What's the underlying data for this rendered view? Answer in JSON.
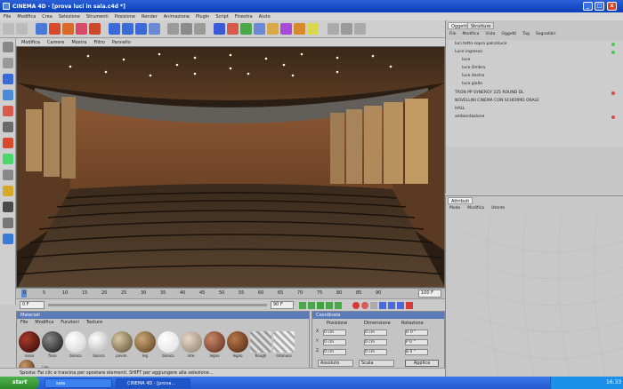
{
  "window": {
    "title": "CINEMA 4D - [prova luci in sala.c4d *]",
    "minimize": "_",
    "maximize": "□",
    "close": "x"
  },
  "menu": [
    "File",
    "Modifica",
    "Crea",
    "Selezione",
    "Strumenti",
    "Posizione",
    "Render",
    "Animazione",
    "Plugin",
    "Script",
    "Finestra",
    "Aiuto"
  ],
  "viewport": {
    "menu": [
      "Modifica",
      "Camere",
      "Mostra",
      "Filtro",
      "Pannello"
    ]
  },
  "timeline": {
    "ticks": [
      "0",
      "5",
      "10",
      "15",
      "20",
      "25",
      "30",
      "35",
      "40",
      "45",
      "50",
      "55",
      "60",
      "65",
      "70",
      "75",
      "80",
      "85",
      "90"
    ],
    "end_field": "100 F"
  },
  "playbar": {
    "frame_field": "0 F",
    "end_field": "90 F"
  },
  "materials": {
    "title": "Materiali",
    "menu": [
      "File",
      "Modifica",
      "Funzioni",
      "Texture"
    ],
    "items": [
      "rosso",
      "fisso",
      "bianco",
      "bianco",
      "pavim.",
      "leg",
      "bianco",
      "inte.",
      "legno",
      "legno",
      "Rough",
      "Intonaco",
      "Leg"
    ]
  },
  "coords": {
    "title": "Coordinate",
    "headers": [
      "Posizione",
      "Dimensione",
      "Rotazione"
    ],
    "rows": [
      {
        "axis": "X",
        "pos": "0 cm",
        "size": "0 cm",
        "rot": "H 0 °"
      },
      {
        "axis": "Y",
        "pos": "0 cm",
        "size": "0 cm",
        "rot": "P 0 °"
      },
      {
        "axis": "Z",
        "pos": "0 cm",
        "size": "0 cm",
        "rot": "B 0 °"
      }
    ],
    "mode": "Assoluto",
    "size_mode": "Scala",
    "apply": "Applica"
  },
  "objects": {
    "tabs": [
      "Oggetti",
      "Strutture"
    ],
    "menu": [
      "File",
      "Modifica",
      "Vista",
      "Oggetti",
      "Tag",
      "Segnalibri"
    ],
    "items": [
      "luci tetto sopra palco\\luce",
      "Luce ingresso",
      "luce",
      "luce Ombra",
      "luce destra",
      "luce gialla",
      "TRON PP SYNERGY 225 ROUND DL",
      "NOVELLINI CINEMA CON SCHERMO ORALE",
      "HALL",
      "ambientazione"
    ]
  },
  "attributes": {
    "title": "Attributi",
    "menu": [
      "Modo",
      "Modifica",
      "Utente"
    ]
  },
  "status": "Sposta: Fai clic e trascina per spostare elementi. SHIFT per aggiungere alla selezione...",
  "taskbar": {
    "start": "start",
    "buttons": [
      "sala",
      "CINEMA 4D - [prova..."
    ],
    "clock": "16.33"
  },
  "colors": {
    "titlebar": "#0a3fb8",
    "taskbar": "#245ad0",
    "start": "#2c8a2c",
    "wood": "#7a4a28"
  }
}
